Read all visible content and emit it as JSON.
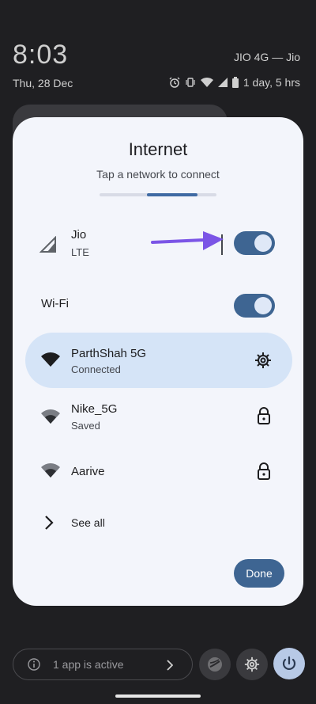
{
  "status_bar": {
    "time": "8:03",
    "carrier": "JIO 4G — Jio",
    "date": "Thu, 28 Dec",
    "battery_text": "1 day, 5 hrs"
  },
  "dialog": {
    "title": "Internet",
    "subtitle": "Tap a network to connect",
    "mobile": {
      "name": "Jio",
      "type": "LTE",
      "enabled": true
    },
    "wifi": {
      "label": "Wi-Fi",
      "enabled": true
    },
    "networks": [
      {
        "name": "ParthShah 5G",
        "status": "Connected",
        "icon": "wifi-full-icon",
        "action_icon": "gear-icon",
        "selected": true
      },
      {
        "name": "Nike_5G",
        "status": "Saved",
        "icon": "wifi-icon",
        "action_icon": "lock-icon",
        "selected": false
      },
      {
        "name": "Aarive",
        "status": "",
        "icon": "wifi-icon",
        "action_icon": "lock-icon",
        "selected": false
      }
    ],
    "see_all": "See all",
    "done": "Done"
  },
  "bottom": {
    "active_apps": "1 app is active"
  },
  "colors": {
    "accent": "#3e6592",
    "selected_row": "#d5e4f7",
    "arrow": "#7b55e6"
  }
}
